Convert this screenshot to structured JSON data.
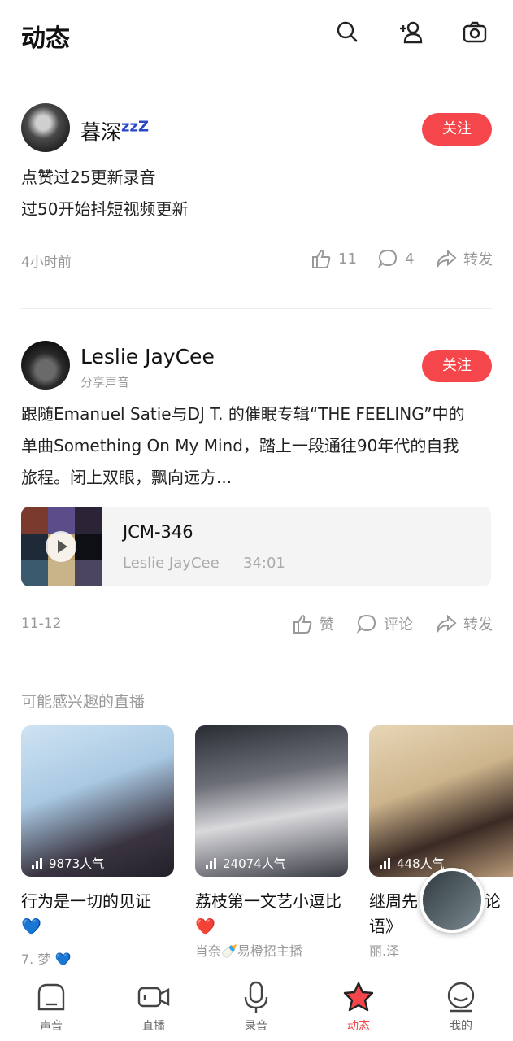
{
  "header": {
    "title": "动态",
    "icons": [
      "search-icon",
      "add-friend-icon",
      "camera-icon"
    ]
  },
  "posts": [
    {
      "username": "暮深",
      "username_suffix": "zzZ",
      "follow_label": "关注",
      "text_lines": [
        "点赞过25更新录音",
        "过50开始抖短视频更新"
      ],
      "time": "4小时前",
      "likes": "11",
      "comments": "4",
      "share_label": "转发"
    },
    {
      "username": "Leslie JayCee",
      "subtitle": "分享声音",
      "follow_label": "关注",
      "text_lines": [
        "跟随Emanuel Satie与DJ T. 的催眠专辑“THE FEELING”中的",
        "单曲Something On My Mind，踏上一段通往90年代的自我",
        "旅程。闭上双眼，飘向远方..."
      ],
      "music": {
        "title": "JCM-346",
        "artist": "Leslie JayCee",
        "duration": "34:01"
      },
      "time": "11-12",
      "like_label": "赞",
      "comment_label": "评论",
      "share_label": "转发"
    }
  ],
  "live": {
    "section_title": "可能感兴趣的直播",
    "items": [
      {
        "popularity": "9873人气",
        "name": "行为是一切的见证",
        "name_emoji": "💙",
        "host": "7. 梦",
        "host_emoji": "💙"
      },
      {
        "popularity": "24074人气",
        "name": "荔枝第一文艺小逗比",
        "name_emoji": "❤️",
        "host": "肖奈🍼易橙招主播"
      },
      {
        "popularity": "448人气",
        "name": "继周先",
        "name_tail": "论",
        "name_line2": "语》",
        "host": "丽.泽"
      }
    ]
  },
  "tabbar": {
    "items": [
      {
        "label": "声音",
        "icon": "home-icon"
      },
      {
        "label": "直播",
        "icon": "video-icon"
      },
      {
        "label": "录音",
        "icon": "microphone-icon"
      },
      {
        "label": "动态",
        "icon": "star-icon",
        "active": true
      },
      {
        "label": "我的",
        "icon": "profile-icon"
      }
    ]
  },
  "colors": {
    "accent": "#f5474b",
    "text_primary": "#111111",
    "text_secondary": "#999999"
  }
}
